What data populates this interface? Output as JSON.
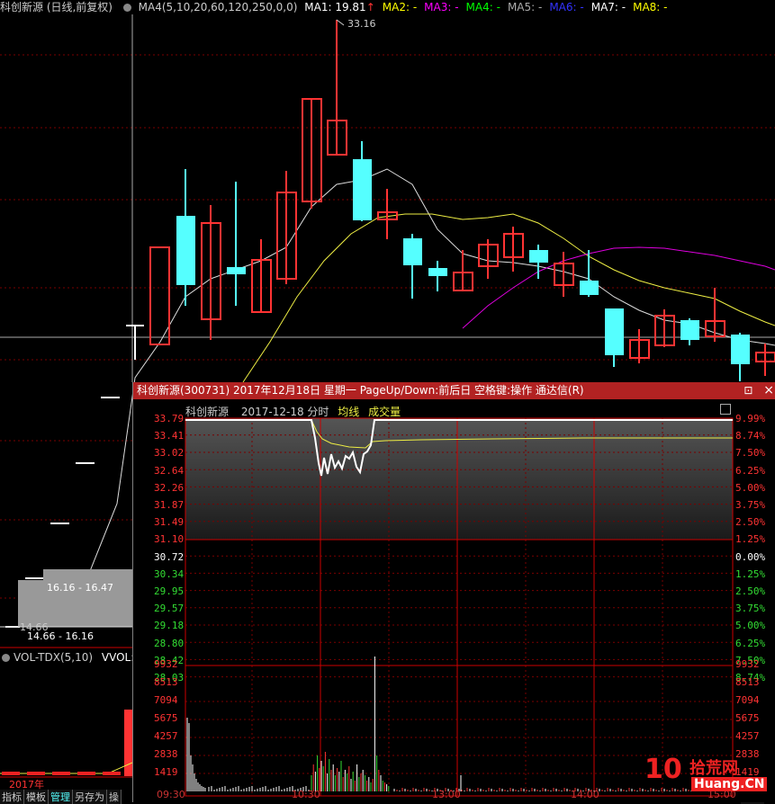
{
  "header": {
    "stock_title": "科创新源 (日线,前复权)",
    "ma_indicator": "MA4(5,10,20,60,120,250,0,0)",
    "ma_items": [
      {
        "label": "MA1: 19.81",
        "color": "#ffffff",
        "arrow": "↑"
      },
      {
        "label": "MA2: -",
        "color": "#ffff00"
      },
      {
        "label": "MA3: -",
        "color": "#ff00ff"
      },
      {
        "label": "MA4: -",
        "color": "#00ff00"
      },
      {
        "label": "MA5: -",
        "color": "#aaaaaa"
      },
      {
        "label": "MA6: -",
        "color": "#3333ff"
      },
      {
        "label": "MA7: -",
        "color": "#ffffff"
      },
      {
        "label": "MA8: -",
        "color": "#ffff00"
      }
    ]
  },
  "candles": {
    "high_label": "33.16",
    "range_labels": [
      "16.16 - 16.47",
      "14.66 - 16.16"
    ],
    "low_label": "14.66"
  },
  "volume_panel": {
    "title": "VOL-TDX(5,10)",
    "value_label": "VVOL:"
  },
  "year_label": "2017年",
  "bottom_tabs": [
    "指标",
    "模板",
    "管理",
    "另存为",
    "操"
  ],
  "bottom_active_index": 2,
  "right_tab": "操作",
  "popup": {
    "title": "科创新源(300731)  2017年12月18日  星期一  PageUp/Down:前后日  空格键:操作  通达信(R)",
    "close_icon": "×",
    "restore_icon": "⊡",
    "stock_name": "科创新源",
    "date_text": "2017-12-18 分时",
    "avg_line_label": "均线",
    "volume_label": "成交量",
    "price_labels": [
      "33.79",
      "33.41",
      "33.02",
      "32.64",
      "32.26",
      "31.87",
      "31.49",
      "31.10",
      "30.72",
      "30.34",
      "29.95",
      "29.57",
      "29.18",
      "28.80",
      "28.42",
      "28.03"
    ],
    "pct_labels": [
      "9.99%",
      "8.74%",
      "7.50%",
      "6.25%",
      "5.00%",
      "3.75%",
      "2.50%",
      "1.25%",
      "0.00%",
      "1.25%",
      "2.50%",
      "3.75%",
      "5.00%",
      "6.25%",
      "7.50%",
      "8.74%"
    ],
    "vol_labels": [
      "9932",
      "8513",
      "7094",
      "5675",
      "4257",
      "2838",
      "1419"
    ],
    "time_labels": [
      "09:30",
      "10:30",
      "13:00",
      "14:00",
      "15:00"
    ]
  },
  "watermark": {
    "text1": "10",
    "text2": "拾荒网",
    "text3": "Huang.CN"
  }
}
